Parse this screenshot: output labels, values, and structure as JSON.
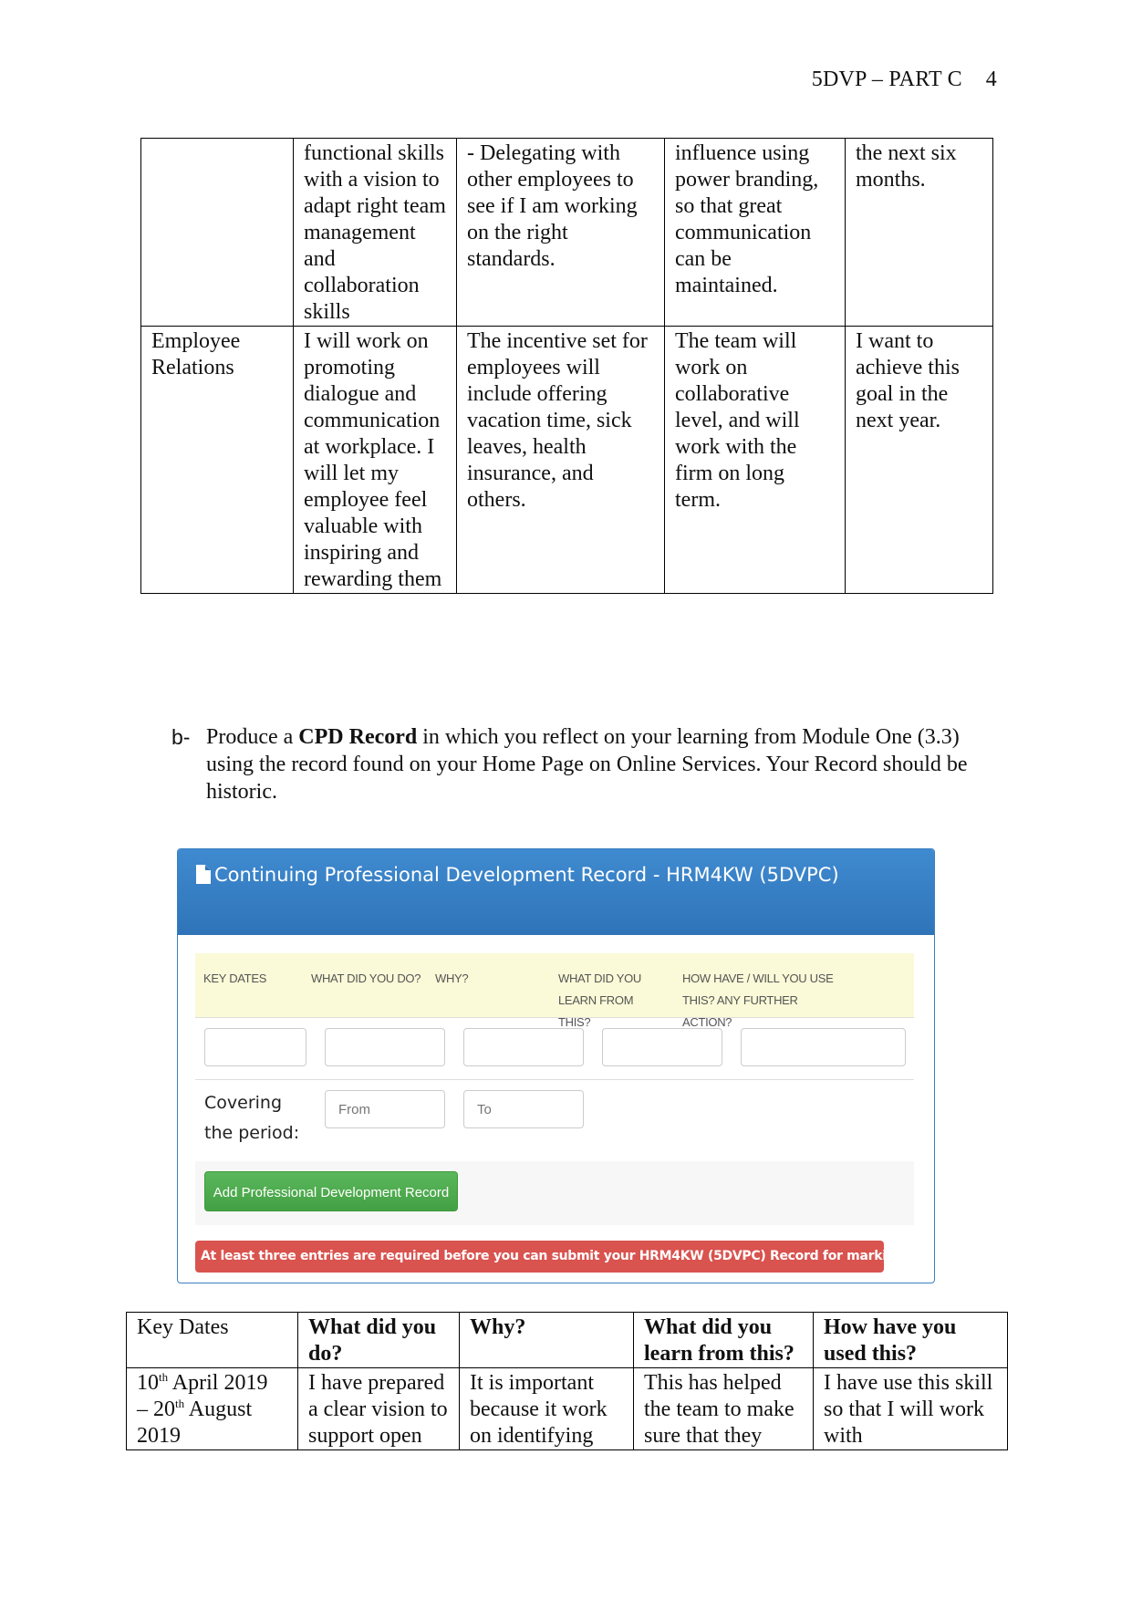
{
  "page_header": {
    "title": "5DVP – PART C",
    "page_number": "4"
  },
  "top_table": {
    "rows": [
      {
        "cells": [
          "",
          "functional skills with a vision to adapt right team management and collaboration skills",
          "- Delegating with other employees to see if I am working on the right standards.",
          "influence using power branding, so that great communication can be maintained.",
          "the next six months."
        ]
      },
      {
        "cells": [
          "Employee Relations",
          "I will work on promoting dialogue and communication at workplace. I will let my employee feel valuable with inspiring and rewarding them",
          "The incentive set for employees will include offering vacation time, sick leaves, health insurance, and others.",
          "The team will work on collaborative level, and will work with the firm on long term.",
          "I want to achieve this goal in the next year."
        ]
      }
    ]
  },
  "instruction": {
    "label": "b-",
    "text_before": "Produce a ",
    "bold": "CPD Record",
    "text_after": " in which you reflect on your learning from Module One (3.3) using the record found on your Home Page on Online Services. Your Record should be historic."
  },
  "cpd_panel": {
    "icon": "document-icon",
    "title": "Continuing Professional Development Record - HRM4KW (5DVPC)",
    "columns": [
      "KEY DATES",
      "WHAT DID YOU DO?",
      "WHY?",
      "WHAT DID YOU LEARN FROM THIS?",
      "HOW HAVE / WILL YOU USE THIS? ANY FURTHER ACTION?"
    ],
    "inputs": [
      "",
      "",
      "",
      "",
      ""
    ],
    "period_label": "Covering the period:",
    "from_placeholder": "From",
    "to_placeholder": "To",
    "add_button": "Add Professional Development Record",
    "alert": "At least three entries are required before you can submit your HRM4KW (5DVPC) Record for marking.",
    "colors": {
      "header_blue": "#3580c4",
      "column_bg": "#fafad8",
      "button_green": "#4cae4c",
      "alert_red": "#d9534f"
    }
  },
  "bottom_table": {
    "headers": [
      "Key Dates",
      "What did you do?",
      "Why?",
      "What did you learn from this?",
      "How have you used this?"
    ],
    "row": {
      "date_start_day": "10",
      "date_start_suffix": "th",
      "date_start_rest": " April 2019",
      "date_end_prefix": "– ",
      "date_end_day": "20",
      "date_end_suffix": "th",
      "date_end_rest": " August 2019",
      "cells": [
        "I have prepared a clear vision to support open",
        "It is important because it work on identifying",
        "This has helped the team to make sure that they",
        "I have use this skill so that I will work with"
      ]
    }
  }
}
